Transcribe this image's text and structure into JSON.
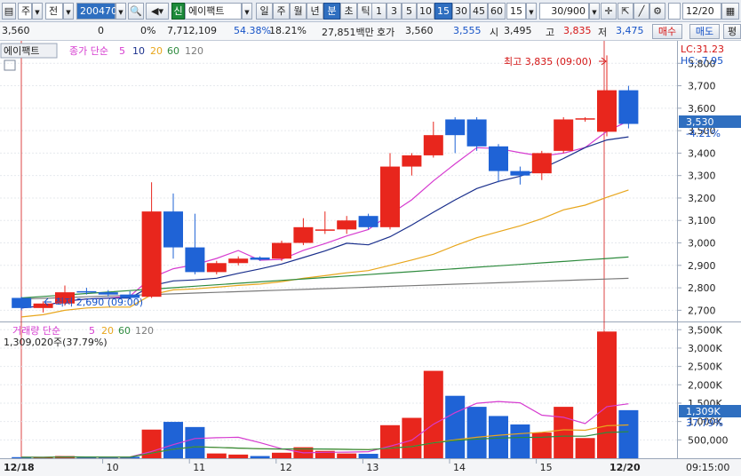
{
  "toolbar": {
    "mode1": "주",
    "mode2": "전",
    "code": "200470",
    "new_badge": "신",
    "stock_name": "에이팩트",
    "periods": [
      "일",
      "주",
      "월",
      "년",
      "분",
      "초",
      "틱"
    ],
    "intervals": [
      "1",
      "3",
      "5",
      "10",
      "15",
      "30",
      "45",
      "60"
    ],
    "interval_value": "15",
    "count": "30/900",
    "date": "12/20"
  },
  "quote": {
    "price": "3,560",
    "change": "0",
    "change_pct": "0%",
    "volume": "7,712,109",
    "vol_ratio": "54.38%",
    "turnover_rate": "18.21%",
    "trade_value": "27,851백만",
    "ask_label": "호가",
    "ask": "3,560",
    "bid": "3,555",
    "open_label": "시",
    "open": "3,495",
    "high_label": "고",
    "high": "3,835",
    "low_label": "저",
    "low": "3,475",
    "buy_label": "매수",
    "sell_label": "매도",
    "eval_label": "평"
  },
  "price_panel": {
    "name_tag": "에이팩트",
    "legend_prefix": "종가 단순",
    "ma_periods": [
      "5",
      "10",
      "20",
      "60",
      "120"
    ],
    "lc": "LC:31.23",
    "hc": "HC:-7.95",
    "high_annotation": "최고 3,835 (09:00)",
    "low_annotation": "최저 2,690 (09:00)",
    "current_price_label": "3,530",
    "current_pct_label": "-4.21%"
  },
  "volume_panel": {
    "legend_prefix": "거래량 단순",
    "ma_periods": [
      "5",
      "20",
      "60",
      "120"
    ],
    "info": "1,309,020주(37.79%)",
    "current_label": "1,309K",
    "current_pct": "37.79%"
  },
  "x_axis": {
    "first_date": "12/18",
    "last_date": "12/20",
    "labels": [
      "10",
      "11",
      "12",
      "13",
      "14",
      "15"
    ],
    "time": "09:15:00"
  },
  "colors": {
    "up": "#e8261d",
    "down": "#1f63d6",
    "ma5": "#d63cd0",
    "ma10": "#1a2f8c",
    "ma20": "#e8a61c",
    "ma60": "#2e8b3e",
    "ma120": "#7a7a7a"
  },
  "chart_data": {
    "type": "candlestick",
    "price_axis": {
      "range": [
        2650,
        3900
      ],
      "ticks": [
        2700,
        2800,
        2900,
        3000,
        3100,
        3200,
        3300,
        3400,
        3500,
        3600,
        3700,
        3800
      ],
      "tick_labels": [
        "2,700",
        "2,800",
        "2,900",
        "3,000",
        "3,100",
        "3,200",
        "3,300",
        "3,400",
        "3,500",
        "3,600",
        "3,700",
        "3,800"
      ]
    },
    "volume_axis": {
      "range": [
        0,
        3700000
      ],
      "ticks": [
        500000,
        1000000,
        1500000,
        2000000,
        2500000,
        3000000,
        3500000
      ],
      "tick_labels": [
        "500,000",
        "1,000K",
        "1,500K",
        "2,000K",
        "2,500K",
        "3,000K",
        "3,500K"
      ]
    },
    "candles": [
      {
        "o": 2755,
        "h": 2760,
        "l": 2700,
        "c": 2710,
        "v": 30000
      },
      {
        "o": 2710,
        "h": 2740,
        "l": 2690,
        "c": 2730,
        "v": 20000
      },
      {
        "o": 2730,
        "h": 2810,
        "l": 2720,
        "c": 2780,
        "v": 60000
      },
      {
        "o": 2785,
        "h": 2800,
        "l": 2770,
        "c": 2780,
        "v": 25000
      },
      {
        "o": 2780,
        "h": 2790,
        "l": 2760,
        "c": 2770,
        "v": 20000
      },
      {
        "o": 2770,
        "h": 2785,
        "l": 2755,
        "c": 2755,
        "v": 40000
      },
      {
        "o": 2760,
        "h": 3270,
        "l": 2755,
        "c": 3140,
        "v": 780000
      },
      {
        "o": 3140,
        "h": 3220,
        "l": 2930,
        "c": 2980,
        "v": 990000
      },
      {
        "o": 2980,
        "h": 3130,
        "l": 2860,
        "c": 2870,
        "v": 850000
      },
      {
        "o": 2870,
        "h": 2920,
        "l": 2860,
        "c": 2910,
        "v": 130000
      },
      {
        "o": 2910,
        "h": 2940,
        "l": 2900,
        "c": 2930,
        "v": 100000
      },
      {
        "o": 2935,
        "h": 2940,
        "l": 2920,
        "c": 2925,
        "v": 60000
      },
      {
        "o": 2930,
        "h": 3010,
        "l": 2920,
        "c": 3000,
        "v": 150000
      },
      {
        "o": 3000,
        "h": 3110,
        "l": 2990,
        "c": 3070,
        "v": 300000
      },
      {
        "o": 3060,
        "h": 3140,
        "l": 3040,
        "c": 3060,
        "v": 200000
      },
      {
        "o": 3060,
        "h": 3120,
        "l": 3040,
        "c": 3100,
        "v": 130000
      },
      {
        "o": 3120,
        "h": 3130,
        "l": 3060,
        "c": 3070,
        "v": 120000
      },
      {
        "o": 3070,
        "h": 3400,
        "l": 3060,
        "c": 3340,
        "v": 900000
      },
      {
        "o": 3340,
        "h": 3400,
        "l": 3300,
        "c": 3390,
        "v": 1100000
      },
      {
        "o": 3390,
        "h": 3540,
        "l": 3380,
        "c": 3480,
        "v": 2380000
      },
      {
        "o": 3550,
        "h": 3560,
        "l": 3400,
        "c": 3480,
        "v": 1700000
      },
      {
        "o": 3550,
        "h": 3560,
        "l": 3410,
        "c": 3430,
        "v": 1400000
      },
      {
        "o": 3430,
        "h": 3440,
        "l": 3270,
        "c": 3320,
        "v": 1150000
      },
      {
        "o": 3320,
        "h": 3340,
        "l": 3260,
        "c": 3300,
        "v": 920000
      },
      {
        "o": 3310,
        "h": 3410,
        "l": 3280,
        "c": 3400,
        "v": 700000
      },
      {
        "o": 3410,
        "h": 3560,
        "l": 3400,
        "c": 3550,
        "v": 1400000
      },
      {
        "o": 3555,
        "h": 3560,
        "l": 3540,
        "c": 3555,
        "v": 550000
      },
      {
        "o": 3495,
        "h": 3835,
        "l": 3475,
        "c": 3680,
        "v": 3450000
      },
      {
        "o": 3680,
        "h": 3700,
        "l": 3510,
        "c": 3530,
        "v": 1309020
      }
    ],
    "session_break_index": 27
  }
}
